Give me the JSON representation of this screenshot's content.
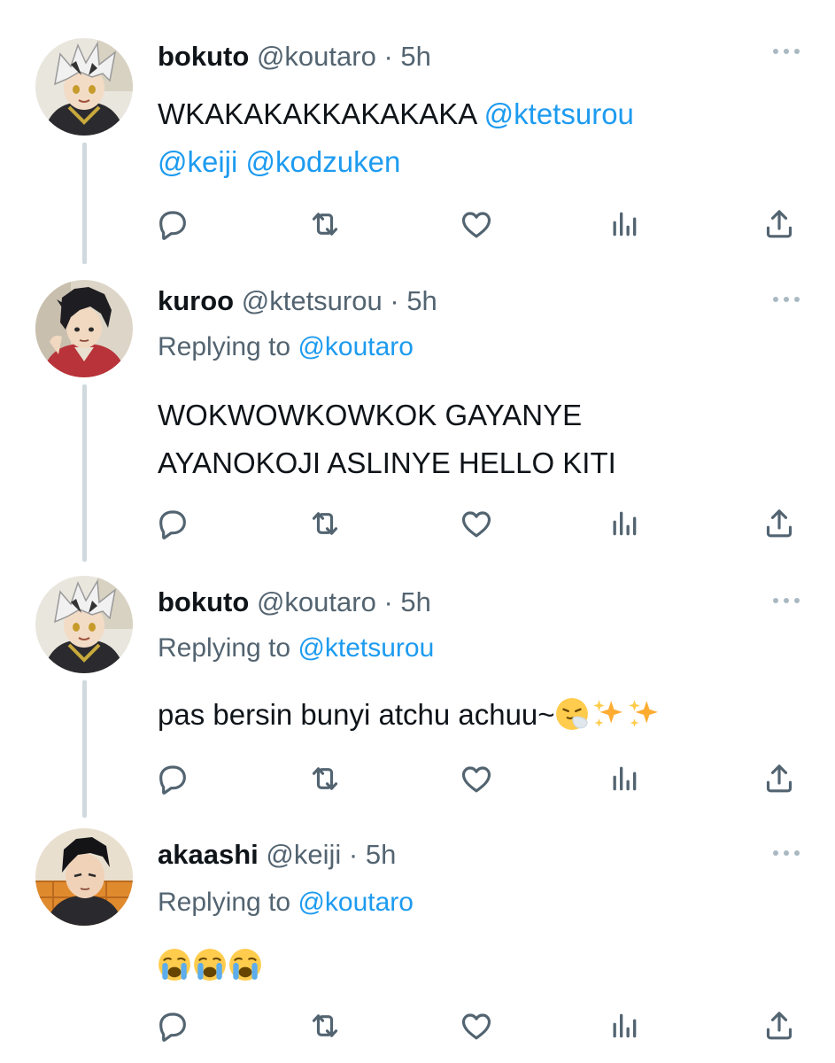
{
  "tweets": [
    {
      "name": "bokuto",
      "handle": "@koutaro",
      "dot": "·",
      "time": "5h",
      "replying_prefix": "",
      "replying_to": "",
      "text_plain": "WKAKAKAKKAKAKAKA ",
      "text_mentions": [
        "@ktetsurou",
        "@keiji",
        "@kodzuken"
      ],
      "avatar_icon": "bokuto-avatar"
    },
    {
      "name": "kuroo",
      "handle": "@ktetsurou",
      "dot": "·",
      "time": "5h",
      "replying_prefix": "Replying to ",
      "replying_to": "@koutaro",
      "text_line1": "WOKWOWKOWKOK GAYANYE",
      "text_line2": "AYANOKOJI ASLINYE HELLO KITI",
      "avatar_icon": "kuroo-avatar"
    },
    {
      "name": "bokuto",
      "handle": "@koutaro",
      "dot": "·",
      "time": "5h",
      "replying_prefix": "Replying to ",
      "replying_to": "@ktetsurou",
      "text": "pas bersin bunyi atchu achuu~",
      "text_emojis": [
        "sneezing-face-emoji",
        "sparkles-emoji",
        "sparkles-emoji"
      ],
      "avatar_icon": "bokuto-avatar"
    },
    {
      "name": "akaashi",
      "handle": "@keiji",
      "dot": "·",
      "time": "5h",
      "replying_prefix": "Replying to ",
      "replying_to": "@koutaro",
      "text_emojis": [
        "loudly-crying-face-emoji",
        "loudly-crying-face-emoji",
        "loudly-crying-face-emoji"
      ],
      "avatar_icon": "akaashi-avatar"
    }
  ],
  "actions": [
    "reply-icon",
    "retweet-icon",
    "like-icon",
    "analytics-icon",
    "share-icon"
  ],
  "colors": {
    "text": "#0f1419",
    "secondary": "#536471",
    "mention": "#1d9bf0",
    "thread_line": "#cfd9de"
  }
}
